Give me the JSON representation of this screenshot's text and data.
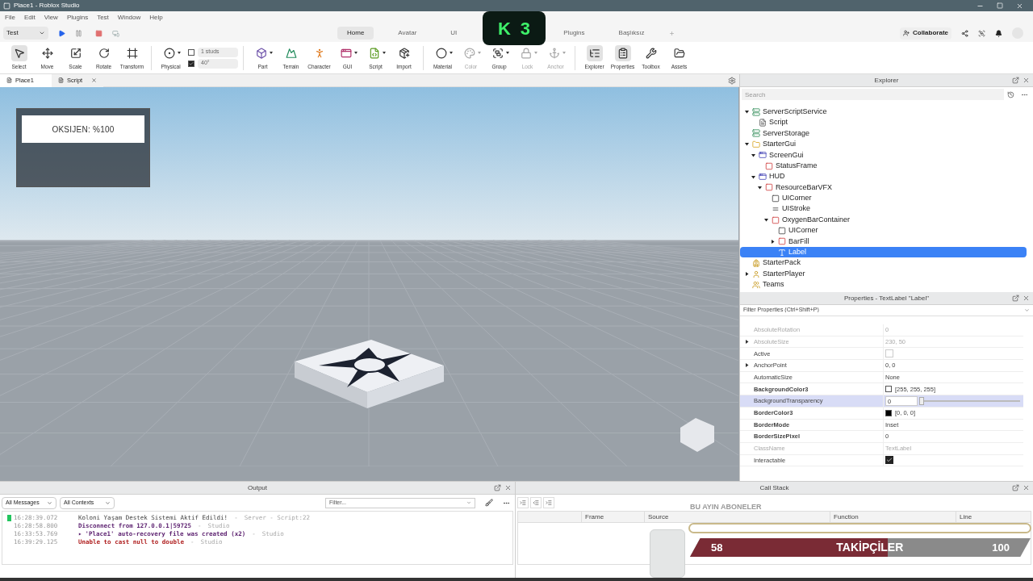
{
  "window": {
    "title": "Place1 - Roblox Studio"
  },
  "menu": [
    "File",
    "Edit",
    "View",
    "Plugins",
    "Test",
    "Window",
    "Help"
  ],
  "run_bar": {
    "mode": "Test"
  },
  "ribbon_tabs": [
    {
      "label": "Home",
      "selected": true
    },
    {
      "label": "Avatar",
      "selected": false
    },
    {
      "label": "UI",
      "selected": false
    },
    {
      "label": "Plugins",
      "selected": false
    },
    {
      "label": "Başlıksız",
      "selected": false
    }
  ],
  "collaborate": "Collaborate",
  "toolbar_groups": [
    [
      {
        "kind": "select",
        "label": "Select",
        "active": true,
        "disabled": false,
        "menu": false
      },
      {
        "kind": "move",
        "label": "Move",
        "active": false,
        "disabled": false,
        "menu": false
      },
      {
        "kind": "scale",
        "label": "Scale",
        "active": false,
        "disabled": false,
        "menu": false
      },
      {
        "kind": "rotate",
        "label": "Rotate",
        "active": false,
        "disabled": false,
        "menu": false
      },
      {
        "kind": "transform",
        "label": "Transform",
        "active": false,
        "disabled": false,
        "menu": false
      }
    ],
    [
      {
        "kind": "physical",
        "label": "Physical",
        "active": false,
        "disabled": false,
        "menu": true
      }
    ],
    [
      {
        "kind": "part",
        "label": "Part",
        "active": false,
        "disabled": false,
        "menu": true
      },
      {
        "kind": "terrain",
        "label": "Terrain",
        "active": false,
        "disabled": false,
        "menu": false
      },
      {
        "kind": "character",
        "label": "Character",
        "active": false,
        "disabled": false,
        "menu": false
      },
      {
        "kind": "gui",
        "label": "GUI",
        "active": false,
        "disabled": false,
        "menu": true
      },
      {
        "kind": "script",
        "label": "Script",
        "active": false,
        "disabled": false,
        "menu": true
      },
      {
        "kind": "import",
        "label": "Import",
        "active": false,
        "disabled": false,
        "menu": false
      }
    ],
    [
      {
        "kind": "material",
        "label": "Material",
        "active": false,
        "disabled": false,
        "menu": true
      },
      {
        "kind": "color",
        "label": "Color",
        "active": false,
        "disabled": true,
        "menu": true
      },
      {
        "kind": "group",
        "label": "Group",
        "active": false,
        "disabled": false,
        "menu": true
      },
      {
        "kind": "lock",
        "label": "Lock",
        "active": false,
        "disabled": true,
        "menu": true
      },
      {
        "kind": "anchor",
        "label": "Anchor",
        "active": false,
        "disabled": true,
        "menu": true
      }
    ],
    [
      {
        "kind": "explorer",
        "label": "Explorer",
        "active": true,
        "disabled": false,
        "menu": false
      },
      {
        "kind": "properties",
        "label": "Properties",
        "active": true,
        "disabled": false,
        "menu": false
      },
      {
        "kind": "toolbox",
        "label": "Toolbox",
        "active": false,
        "disabled": false,
        "menu": false
      },
      {
        "kind": "assets",
        "label": "Assets",
        "active": false,
        "disabled": false,
        "menu": false
      }
    ]
  ],
  "snap": [
    {
      "value": "1 studs",
      "checked": false
    },
    {
      "value": "40°",
      "checked": true
    }
  ],
  "document_tabs": [
    {
      "label": "Place1",
      "selected": true
    },
    {
      "label": "Script",
      "selected": false
    }
  ],
  "viewport": {
    "gui_label": "OKSIJEN: %100"
  },
  "explorer": {
    "title": "Explorer",
    "search_placeholder": "Search",
    "tree": [
      {
        "name": "ServerScriptService",
        "kind": "service",
        "expanded": true,
        "selected": false,
        "children": [
          {
            "name": "Script",
            "kind": "script",
            "selected": false
          }
        ]
      },
      {
        "name": "ServerStorage",
        "kind": "storage",
        "selected": false
      },
      {
        "name": "StarterGui",
        "kind": "folder",
        "expanded": true,
        "selected": false,
        "children": [
          {
            "name": "ScreenGui",
            "kind": "screengui",
            "expanded": true,
            "selected": false,
            "children": [
              {
                "name": "StatusFrame",
                "kind": "frame",
                "selected": false
              }
            ]
          },
          {
            "name": "HUD",
            "kind": "screengui",
            "expanded": true,
            "selected": false,
            "children": [
              {
                "name": "ResourceBarVFX",
                "kind": "frame",
                "expanded": true,
                "selected": false,
                "children": [
                  {
                    "name": "UICorner",
                    "kind": "corner",
                    "selected": false
                  },
                  {
                    "name": "UIStroke",
                    "kind": "stroke",
                    "selected": false
                  },
                  {
                    "name": "OxygenBarContainer",
                    "kind": "frame",
                    "expanded": true,
                    "selected": false,
                    "children": [
                      {
                        "name": "UICorner",
                        "kind": "corner",
                        "selected": false
                      },
                      {
                        "name": "BarFill",
                        "kind": "frame",
                        "expanded": false,
                        "selected": false
                      },
                      {
                        "name": "Label",
                        "kind": "textlabel",
                        "selected": true
                      }
                    ]
                  }
                ]
              }
            ]
          }
        ]
      },
      {
        "name": "StarterPack",
        "kind": "pack",
        "selected": false
      },
      {
        "name": "StarterPlayer",
        "kind": "player",
        "expanded": false,
        "selected": false
      },
      {
        "name": "Teams",
        "kind": "teams",
        "selected": false
      }
    ]
  },
  "properties": {
    "title": "Properties - TextLabel \"Label\"",
    "filter_placeholder": "Filter Properties (Ctrl+Shift+P)",
    "rows": [
      {
        "name": "AbsoluteRotation",
        "kind": "text",
        "value": "0",
        "bold": false,
        "readonly": true,
        "expandable": false,
        "selected": false
      },
      {
        "name": "AbsoluteSize",
        "kind": "text",
        "value": "230, 50",
        "bold": false,
        "readonly": true,
        "expandable": true,
        "selected": false
      },
      {
        "name": "Active",
        "kind": "checkbox",
        "checked": false,
        "bold": false,
        "readonly": false,
        "expandable": false,
        "selected": false
      },
      {
        "name": "AnchorPoint",
        "kind": "text",
        "value": "0, 0",
        "bold": false,
        "readonly": false,
        "expandable": true,
        "selected": false
      },
      {
        "name": "AutomaticSize",
        "kind": "text",
        "value": "None",
        "bold": false,
        "readonly": false,
        "expandable": false,
        "selected": false
      },
      {
        "name": "BackgroundColor3",
        "kind": "color",
        "color": "#ffffff",
        "value": "[255, 255, 255]",
        "bold": true,
        "readonly": false,
        "expandable": false,
        "selected": false
      },
      {
        "name": "BackgroundTransparency",
        "kind": "slider",
        "value": "0",
        "level": 0,
        "bold": false,
        "readonly": false,
        "expandable": false,
        "selected": true
      },
      {
        "name": "BorderColor3",
        "kind": "color",
        "color": "#000000",
        "value": "[0, 0, 0]",
        "bold": true,
        "readonly": false,
        "expandable": false,
        "selected": false
      },
      {
        "name": "BorderMode",
        "kind": "text",
        "value": "Inset",
        "bold": true,
        "readonly": false,
        "expandable": false,
        "selected": false
      },
      {
        "name": "BorderSizePixel",
        "kind": "text",
        "value": "0",
        "bold": true,
        "readonly": false,
        "expandable": false,
        "selected": false
      },
      {
        "name": "ClassName",
        "kind": "text",
        "value": "TextLabel",
        "bold": false,
        "readonly": true,
        "expandable": false,
        "selected": false
      },
      {
        "name": "Interactable",
        "kind": "checkbox",
        "checked": true,
        "bold": false,
        "readonly": false,
        "expandable": false,
        "selected": false
      }
    ]
  },
  "output": {
    "title": "Output",
    "filters": [
      "All Messages",
      "All Contexts"
    ],
    "filter_placeholder": "Filter...",
    "lines": [
      {
        "time": "16:28:39.072",
        "message": "Koloni Yaşam Destek Sistemi Aktif Edildi!",
        "separator": "-",
        "source": "Server - Script:22",
        "kind": "info",
        "flagged": true
      },
      {
        "time": "16:28:58.800",
        "message": "Disconnect from 127.0.0.1|59725",
        "separator": "-",
        "source": "Studio",
        "kind": "system"
      },
      {
        "time": "16:33:53.769",
        "toggle": "▸",
        "message": "'Place1' auto-recovery file was created (x2)",
        "separator": "-",
        "source": "Studio",
        "kind": "system"
      },
      {
        "time": "16:39:29.125",
        "message": "Unable to cast null to double",
        "separator": "-",
        "source": "Studio",
        "kind": "error"
      }
    ]
  },
  "call_stack": {
    "title": "Call Stack",
    "columns": [
      "Frame",
      "Source",
      "Function",
      "Line"
    ]
  },
  "stream_overlay": {
    "badge": [
      "K",
      "3"
    ],
    "goal_title": "BU AYIN ABONELER",
    "followers": {
      "current": "58",
      "label": "TAKİPÇİLER",
      "target": "100",
      "level": 0.58
    }
  }
}
